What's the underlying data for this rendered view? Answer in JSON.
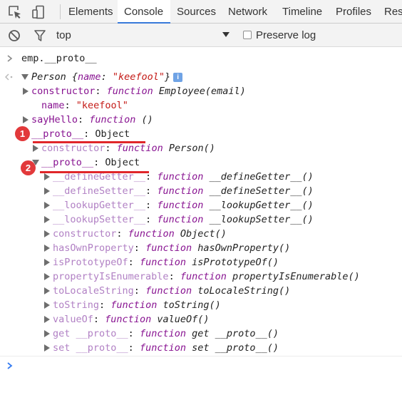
{
  "tabs": [
    {
      "label": "Elements",
      "active": false
    },
    {
      "label": "Console",
      "active": true
    },
    {
      "label": "Sources",
      "active": false
    },
    {
      "label": "Network",
      "active": false
    },
    {
      "label": "Timeline",
      "active": false
    },
    {
      "label": "Profiles",
      "active": false
    },
    {
      "label": "Reso",
      "active": false
    }
  ],
  "toolbar": {
    "context": "top",
    "preserve_log_label": "Preserve log",
    "preserve_log_checked": false
  },
  "console": {
    "input_command": "emp.__proto__",
    "result": {
      "class_name": "Person",
      "preview_key": "name",
      "preview_value": "\"keefool\"",
      "info_icon": "i"
    },
    "entries": [
      {
        "key": "constructor",
        "sep": ": ",
        "kw": "function",
        "name": "Employee(email)"
      },
      {
        "key": "name",
        "sep": ": ",
        "str": "\"keefool\""
      },
      {
        "key": "sayHello",
        "sep": ": ",
        "kw": "function",
        "name": "()"
      },
      {
        "key": "__proto__",
        "sep": ": ",
        "val": "Object"
      },
      {
        "key": "constructor",
        "sep": ": ",
        "kw": "function",
        "name": "Person()"
      },
      {
        "key": "__proto__",
        "sep": ": ",
        "val": "Object"
      },
      {
        "key": "__defineGetter__",
        "sep": ": ",
        "kw": "function",
        "name": "__defineGetter__()"
      },
      {
        "key": "__defineSetter__",
        "sep": ": ",
        "kw": "function",
        "name": "__defineSetter__()"
      },
      {
        "key": "__lookupGetter__",
        "sep": ": ",
        "kw": "function",
        "name": "__lookupGetter__()"
      },
      {
        "key": "__lookupSetter__",
        "sep": ": ",
        "kw": "function",
        "name": "__lookupSetter__()"
      },
      {
        "key": "constructor",
        "sep": ": ",
        "kw": "function",
        "name": "Object()"
      },
      {
        "key": "hasOwnProperty",
        "sep": ": ",
        "kw": "function",
        "name": "hasOwnProperty()"
      },
      {
        "key": "isPrototypeOf",
        "sep": ": ",
        "kw": "function",
        "name": "isPrototypeOf()"
      },
      {
        "key": "propertyIsEnumerable",
        "sep": ": ",
        "kw": "function",
        "name": "propertyIsEnumerable()"
      },
      {
        "key": "toLocaleString",
        "sep": ": ",
        "kw": "function",
        "name": "toLocaleString()"
      },
      {
        "key": "toString",
        "sep": ": ",
        "kw": "function",
        "name": "toString()"
      },
      {
        "key": "valueOf",
        "sep": ": ",
        "kw": "function",
        "name": "valueOf()"
      },
      {
        "key": "get __proto__",
        "sep": ": ",
        "kw": "function",
        "name": "get __proto__()"
      },
      {
        "key": "set __proto__",
        "sep": ": ",
        "kw": "function",
        "name": "set __proto__()"
      }
    ]
  },
  "annotations": [
    "1",
    "2"
  ],
  "colors": {
    "accent_tab": "#3879d9",
    "annotation_red": "#e2393b",
    "property_key": "#881391",
    "string_value": "#c41a16",
    "prompt_blue": "#367cf1"
  },
  "icons": [
    "inspect-element-icon",
    "device-mode-icon",
    "clear-console-icon",
    "filter-icon",
    "dropdown-arrow-icon",
    "info-icon"
  ]
}
